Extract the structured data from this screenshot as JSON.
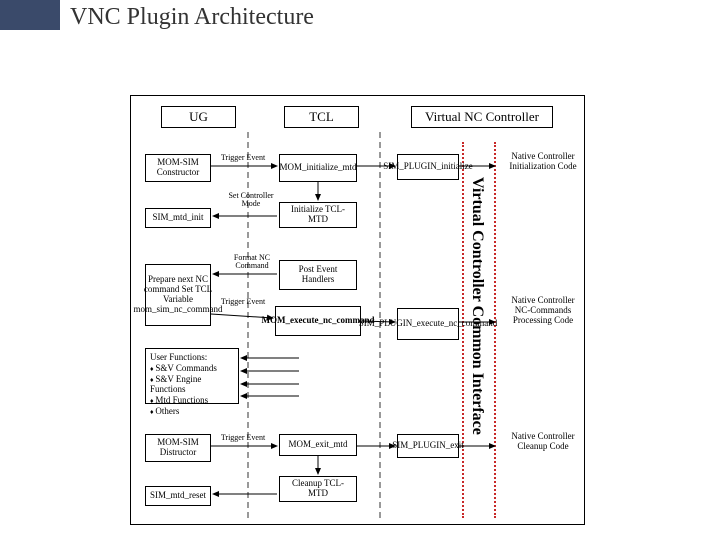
{
  "title": "VNC Plugin Architecture",
  "columns": {
    "ug": "UG",
    "tcl": "TCL",
    "vnc": "Virtual NC Controller"
  },
  "labels": {
    "trigger_event1": "Trigger Event",
    "trigger_event2": "Trigger Event",
    "trigger_event3": "Trigger Event",
    "set_controller_mode": "Set Controller Mode",
    "format_nc_command": "Format NC Command"
  },
  "boxes": {
    "mom_sim_constructor": "MOM-SIM Constructor",
    "sim_mtd_init": "SIM_mtd_init",
    "prepare_next": "Prepare next NC command Set TCL Variable mom_sim_nc_command",
    "mom_sim_distructor": "MOM-SIM Distructor",
    "sim_mtd_reset": "SIM_mtd_reset",
    "mom_initialize_mtd": "MOM_initialize_mtd",
    "initialize_tcl_mtd": "Initialize TCL-MTD",
    "post_event_handlers": "Post Event Handlers",
    "mom_execute_nc": "MOM_execute_nc_command",
    "mom_exit_mtd": "MOM_exit_mtd",
    "cleanup_tcl_mtd": "Cleanup TCL-MTD",
    "sim_plugin_initialize": "SIM_PLUGIN_initialize",
    "sim_plugin_execute": "SIM_PLUGIN_execute_nc_command",
    "sim_plugin_exit": "SIM_PLUGIN_exit",
    "user_functions_title": "User Functions:",
    "user_fn1": "S&V Commands",
    "user_fn2": "S&V Engine Functions",
    "user_fn3": "Mtd Functions",
    "user_fn4": "Others"
  },
  "notes": {
    "init": "Native Controller Initialization Code",
    "proc": "Native Controller NC-Commands Processing Code",
    "cleanup": "Native Controller Cleanup Code"
  },
  "vertical": "Virtual Controller Common Interface"
}
